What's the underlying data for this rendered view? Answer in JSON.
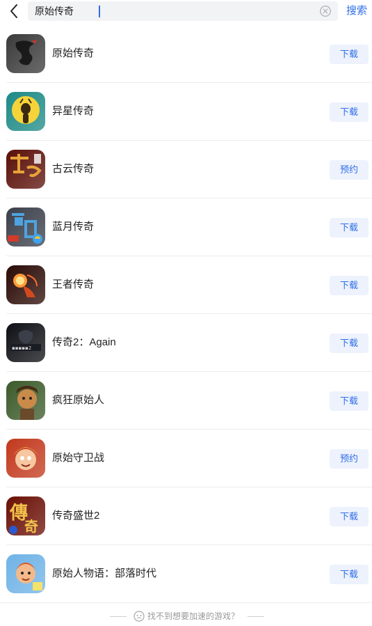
{
  "search": {
    "query": "原始传奇",
    "button_label": "搜索"
  },
  "results": [
    {
      "name": "原始传奇",
      "action": "下载",
      "icon": "dragon-calligraphy-icon",
      "colors": [
        "#3a3a3a",
        "#9a9a9a"
      ]
    },
    {
      "name": "异星传奇",
      "action": "下载",
      "icon": "alien-character-icon",
      "colors": [
        "#1c8a86",
        "#f5d43a"
      ]
    },
    {
      "name": "古云传奇",
      "action": "预约",
      "icon": "ancient-cloud-calligraphy-icon",
      "colors": [
        "#5a0f08",
        "#e8a33a"
      ]
    },
    {
      "name": "蓝月传奇",
      "action": "下载",
      "icon": "blue-moon-calligraphy-icon",
      "colors": [
        "#3a3f4a",
        "#4ea3e0"
      ]
    },
    {
      "name": "王者传奇",
      "action": "下载",
      "icon": "warrior-orb-icon",
      "colors": [
        "#2a0a05",
        "#d14a1e"
      ]
    },
    {
      "name": "传奇2：Again",
      "action": "下载",
      "icon": "dark-knight-icon",
      "colors": [
        "#0d0f14",
        "#7a2a2a"
      ]
    },
    {
      "name": "疯狂原始人",
      "action": "下载",
      "icon": "caveman-boy-icon",
      "colors": [
        "#3b5a2a",
        "#c98a4a"
      ]
    },
    {
      "name": "原始守卫战",
      "action": "预约",
      "icon": "caveman-warrior-icon",
      "colors": [
        "#c2381c",
        "#f0b24a"
      ]
    },
    {
      "name": "传奇盛世2",
      "action": "下载",
      "icon": "golden-calligraphy-icon",
      "colors": [
        "#6a0f05",
        "#f2c14a"
      ]
    },
    {
      "name": "原始人物语：部落时代",
      "action": "下载",
      "icon": "tribe-boy-icon",
      "colors": [
        "#6fb3e6",
        "#e0582a"
      ]
    }
  ],
  "footer": {
    "text": "找不到想要加速的游戏？"
  },
  "accent_color": "#2f6ee8"
}
